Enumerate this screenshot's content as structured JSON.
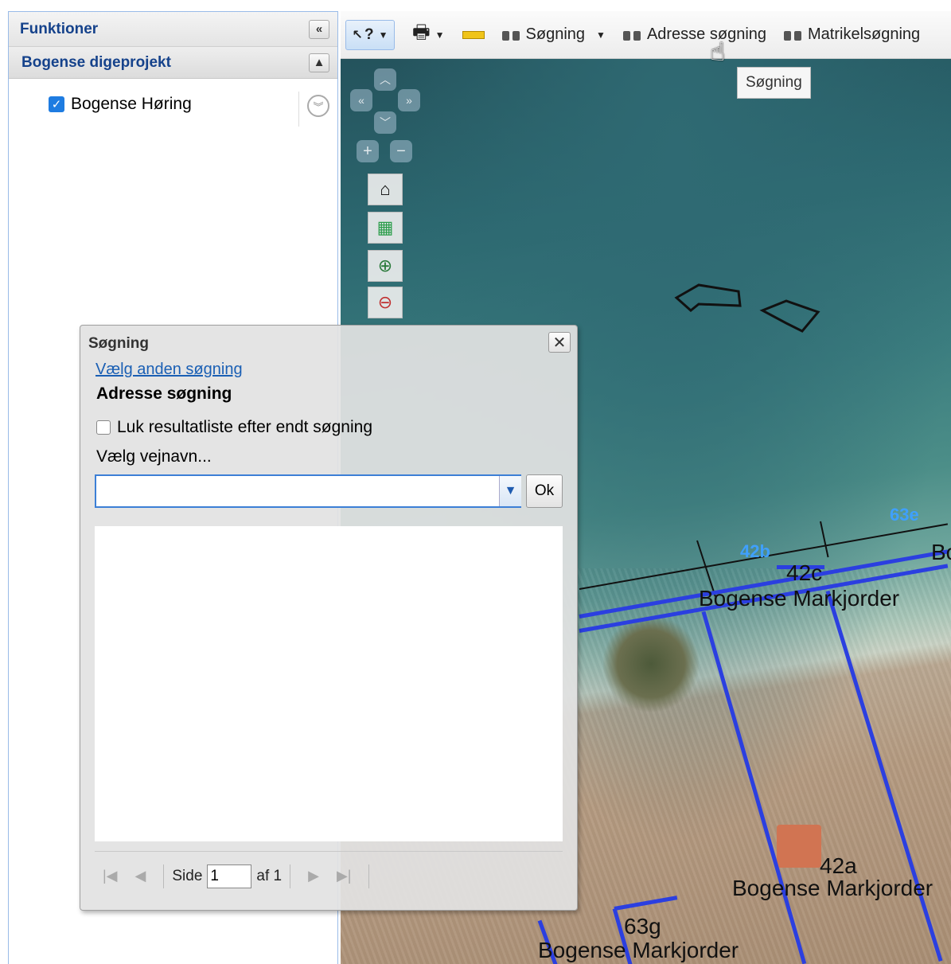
{
  "left_panel": {
    "title": "Funktioner",
    "collapse_icon": "«",
    "project_title": "Bogense digeprojekt",
    "project_collapse_icon": "▲",
    "layer": {
      "label": "Bogense Høring",
      "checked": true
    }
  },
  "toolbar": {
    "identify_label": "?",
    "search_label": "Søgning",
    "address_search_label": "Adresse søgning",
    "cadastre_search_label": "Matrikelsøgning"
  },
  "tooltip": "Søgning",
  "map": {
    "labels": [
      {
        "text": "Bogense Markjorder",
        "kind": "district"
      },
      {
        "text": "42c",
        "kind": "parcel"
      },
      {
        "text": "42a",
        "kind": "parcel"
      },
      {
        "text": "Bogense Markjorder",
        "kind": "district"
      },
      {
        "text": "63g",
        "kind": "parcel"
      },
      {
        "text": "Bogense Markjorder",
        "kind": "district"
      },
      {
        "text": "42b",
        "kind": "overlay"
      },
      {
        "text": "63e",
        "kind": "overlay"
      },
      {
        "text": "Bo",
        "kind": "district"
      }
    ]
  },
  "dialog": {
    "title": "Søgning",
    "close_icon": "✕",
    "link": "Vælg anden søgning",
    "heading": "Adresse søgning",
    "checkbox_label": "Luk resultatliste efter endt søgning",
    "field_label": "Vælg vejnavn...",
    "field_value": "",
    "ok_label": "Ok",
    "pager": {
      "side_label": "Side",
      "page_value": "1",
      "of_label": "af 1"
    }
  }
}
